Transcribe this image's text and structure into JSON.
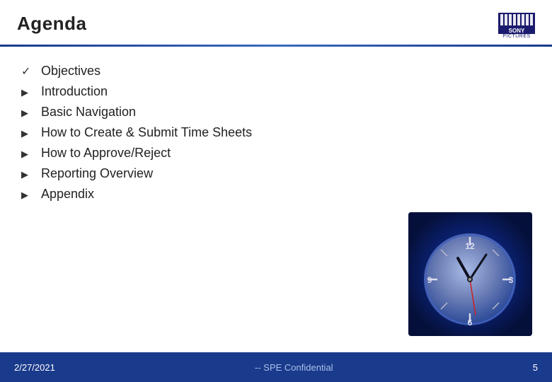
{
  "header": {
    "title": "Agenda",
    "logo_name": "SONY",
    "logo_sub": "PICTURES"
  },
  "agenda": {
    "items": [
      {
        "bullet": "✓",
        "text": "Objectives",
        "type": "check"
      },
      {
        "bullet": "Ø",
        "text": "Introduction",
        "type": "arrow"
      },
      {
        "bullet": "Ø",
        "text": "Basic Navigation",
        "type": "arrow"
      },
      {
        "bullet": "Ø",
        "text": "How to Create & Submit Time Sheets",
        "type": "arrow"
      },
      {
        "bullet": "Ø",
        "text": "How to Approve/Reject",
        "type": "arrow"
      },
      {
        "bullet": "Ø",
        "text": "Reporting Overview",
        "type": "arrow"
      },
      {
        "bullet": "Ø",
        "text": "Appendix",
        "type": "arrow"
      }
    ]
  },
  "footer": {
    "date": "2/27/2021",
    "confidential": "-- SPE Confidential",
    "page": "5"
  }
}
